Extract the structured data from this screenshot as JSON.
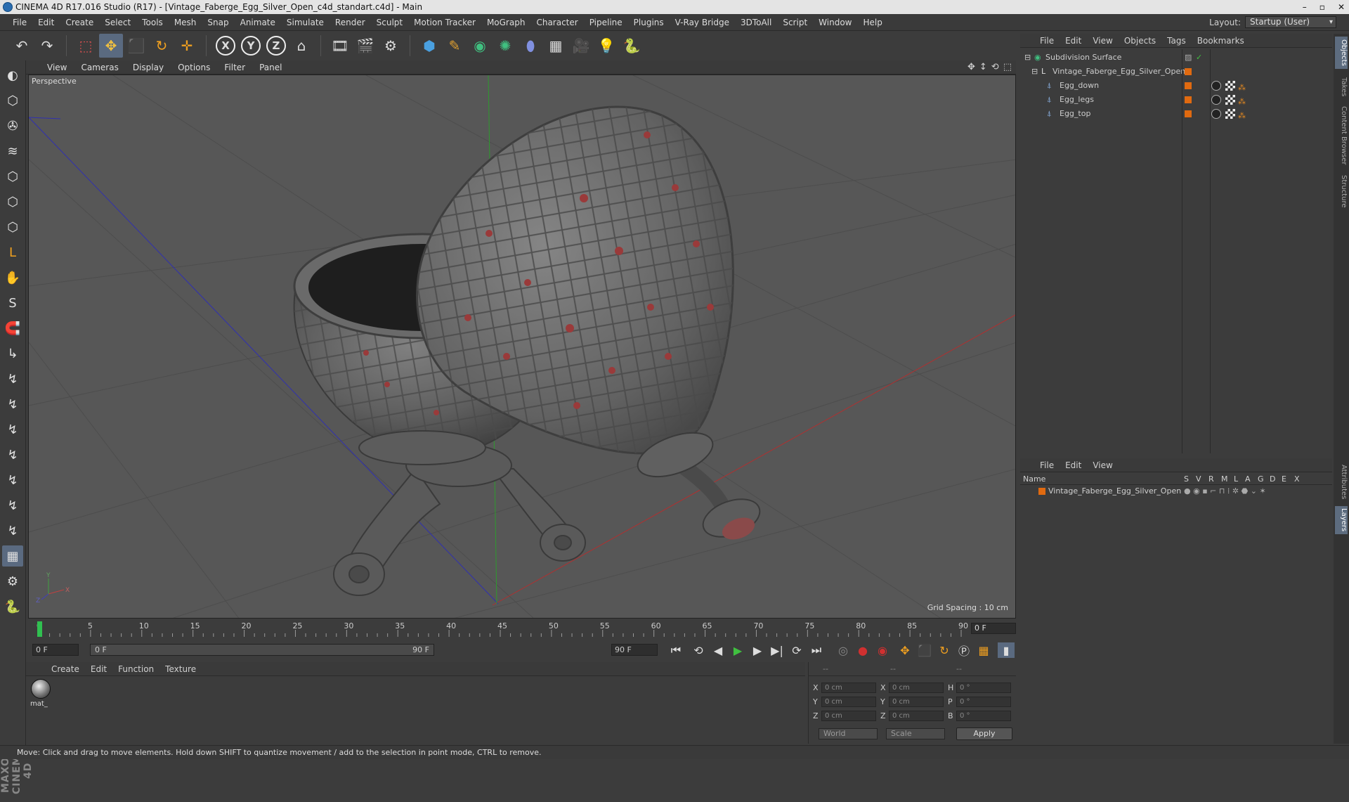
{
  "window": {
    "title": "CINEMA 4D R17.016 Studio (R17) - [Vintage_Faberge_Egg_Silver_Open_c4d_standart.c4d] - Main",
    "controls": [
      "–",
      "▫",
      "✕"
    ]
  },
  "menu": [
    "File",
    "Edit",
    "Create",
    "Select",
    "Tools",
    "Mesh",
    "Snap",
    "Animate",
    "Simulate",
    "Render",
    "Sculpt",
    "Motion Tracker",
    "MoGraph",
    "Character",
    "Pipeline",
    "Plugins",
    "V-Ray Bridge",
    "3DToAll",
    "Script",
    "Window",
    "Help"
  ],
  "layout": {
    "label": "Layout:",
    "value": "Startup (User)"
  },
  "toolbar": {
    "undo": "↶",
    "redo": "↷",
    "live_select": "⬚",
    "move": "✥",
    "scale": "⬛",
    "rotate": "↻",
    "transform": "✛",
    "x": "X",
    "y": "Y",
    "z": "Z",
    "coord": "⌂",
    "render_view": "🎞",
    "render": "🎬",
    "render_settings": "⚙",
    "cube": "⬢",
    "pen": "✎",
    "nurbs": "◉",
    "array": "✺",
    "deformer": "⬮",
    "floor": "▦",
    "camera": "🎥",
    "light": "💡",
    "python": "🐍"
  },
  "left_tools": [
    "◐",
    "⬡",
    "✇",
    "≋",
    "⬡",
    "⬡",
    "⬡",
    "L",
    "✋",
    "S",
    "🧲",
    "↳",
    "↯",
    "↯",
    "↯",
    "↯",
    "↯",
    "↯",
    "↯",
    "▦",
    "⚙",
    "🐍"
  ],
  "brand": "MAXON CINEMA 4D",
  "viewport": {
    "menu": [
      "View",
      "Cameras",
      "Display",
      "Options",
      "Filter",
      "Panel"
    ],
    "nav_icons": [
      "✥",
      "↕",
      "⟲",
      "⬚"
    ],
    "label": "Perspective",
    "grid_spacing": "Grid Spacing : 10 cm",
    "axes": {
      "x": "X",
      "y": "Y",
      "z": "Z"
    }
  },
  "timeline": {
    "ticks": [
      "0",
      "5",
      "10",
      "15",
      "20",
      "25",
      "30",
      "35",
      "40",
      "45",
      "50",
      "55",
      "60",
      "65",
      "70",
      "75",
      "80",
      "85",
      "90"
    ],
    "current_frame": "0 F",
    "start": "0 F",
    "range_start": "0 F",
    "range_end": "90 F",
    "end": "90 F"
  },
  "transport": [
    "⏮",
    "⟲",
    "◀",
    "▶",
    "▶",
    "▶|",
    "⟳",
    "⏭"
  ],
  "materials": {
    "menu": [
      "Create",
      "Edit",
      "Function",
      "Texture"
    ],
    "items": [
      {
        "name": "mat_"
      }
    ]
  },
  "coords": {
    "header": [
      "--",
      "--",
      "--"
    ],
    "rows": [
      {
        "a": "X",
        "av": "0 cm",
        "b": "X",
        "bv": "0 cm",
        "c": "H",
        "cv": "0 °"
      },
      {
        "a": "Y",
        "av": "0 cm",
        "b": "Y",
        "bv": "0 cm",
        "c": "P",
        "cv": "0 °"
      },
      {
        "a": "Z",
        "av": "0 cm",
        "b": "Z",
        "bv": "0 cm",
        "c": "B",
        "cv": "0 °"
      }
    ],
    "world": "World",
    "scale": "Scale",
    "apply": "Apply"
  },
  "status": "Move: Click and drag to move elements. Hold down SHIFT to quantize movement / add to the selection in point mode, CTRL to remove.",
  "objects": {
    "menu": [
      "File",
      "Edit",
      "View",
      "Objects",
      "Tags",
      "Bookmarks"
    ],
    "items": [
      {
        "name": "Subdivision Surface",
        "depth": 0
      },
      {
        "name": "Vintage_Faberge_Egg_Silver_Open",
        "depth": 1
      },
      {
        "name": "Egg_down",
        "depth": 2
      },
      {
        "name": "Egg_legs",
        "depth": 2
      },
      {
        "name": "Egg_top",
        "depth": 2
      }
    ]
  },
  "layers": {
    "menu": [
      "File",
      "Edit",
      "View"
    ],
    "columns": {
      "name": "Name",
      "s": "S",
      "v": "V",
      "r": "R",
      "m": "M",
      "l": "L",
      "a": "A",
      "g": "G",
      "d": "D",
      "e": "E",
      "x": "X"
    },
    "row": "Vintage_Faberge_Egg_Silver_Open"
  },
  "side_tabs": [
    "Objects",
    "Takes",
    "Content Browser",
    "Structure",
    "Attributes",
    "Layers"
  ]
}
